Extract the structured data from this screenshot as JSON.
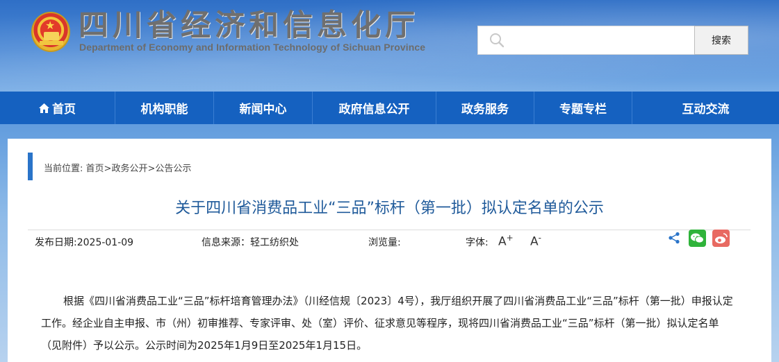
{
  "header": {
    "title": "四川省经济和信息化厅",
    "subtitle": "Department of Economy and Information Technology of Sichuan Province",
    "search": {
      "placeholder": "",
      "button_label": "搜索"
    }
  },
  "nav": {
    "items": [
      {
        "label": "首页",
        "icon": "home-icon"
      },
      {
        "label": "机构职能"
      },
      {
        "label": "新闻中心"
      },
      {
        "label": "政府信息公开"
      },
      {
        "label": "政务服务"
      },
      {
        "label": "专题专栏"
      },
      {
        "label": "互动交流"
      }
    ]
  },
  "breadcrumb": {
    "prefix": "当前位置: ",
    "items": [
      "首页",
      "政务公开",
      "公告公示"
    ],
    "separator": ">"
  },
  "article": {
    "title": "关于四川省消费品工业“三品”标杆（第一批）拟认定名单的公示",
    "publish_date": "发布日期:2025-01-09",
    "source": "信息来源：轻工纺织处",
    "views": "浏览量:",
    "font_size_label": "字体:",
    "font_increase": "A",
    "font_increase_mark": "+",
    "font_decrease": "A",
    "font_decrease_mark": "-",
    "body": "根据《四川省消费品工业“三品”标杆培育管理办法》（川经信规〔2023〕4号），我厅组织开展了四川省消费品工业“三品”标杆（第一批）申报认定工作。经企业自主申报、市（州）初审推荐、专家评审、处（室）评价、征求意见等程序，现将四川省消费品工业“三品”标杆（第一批）拟认定名单（见附件）予以公示。公示时间为2025年1月9日至2025年1月15日。"
  },
  "colors": {
    "nav_bg": "#1561c0",
    "title_color": "#1f5a9a",
    "accent": "#2a74c9",
    "wechat": "#2fb33a",
    "weibo": "#e86a62"
  }
}
